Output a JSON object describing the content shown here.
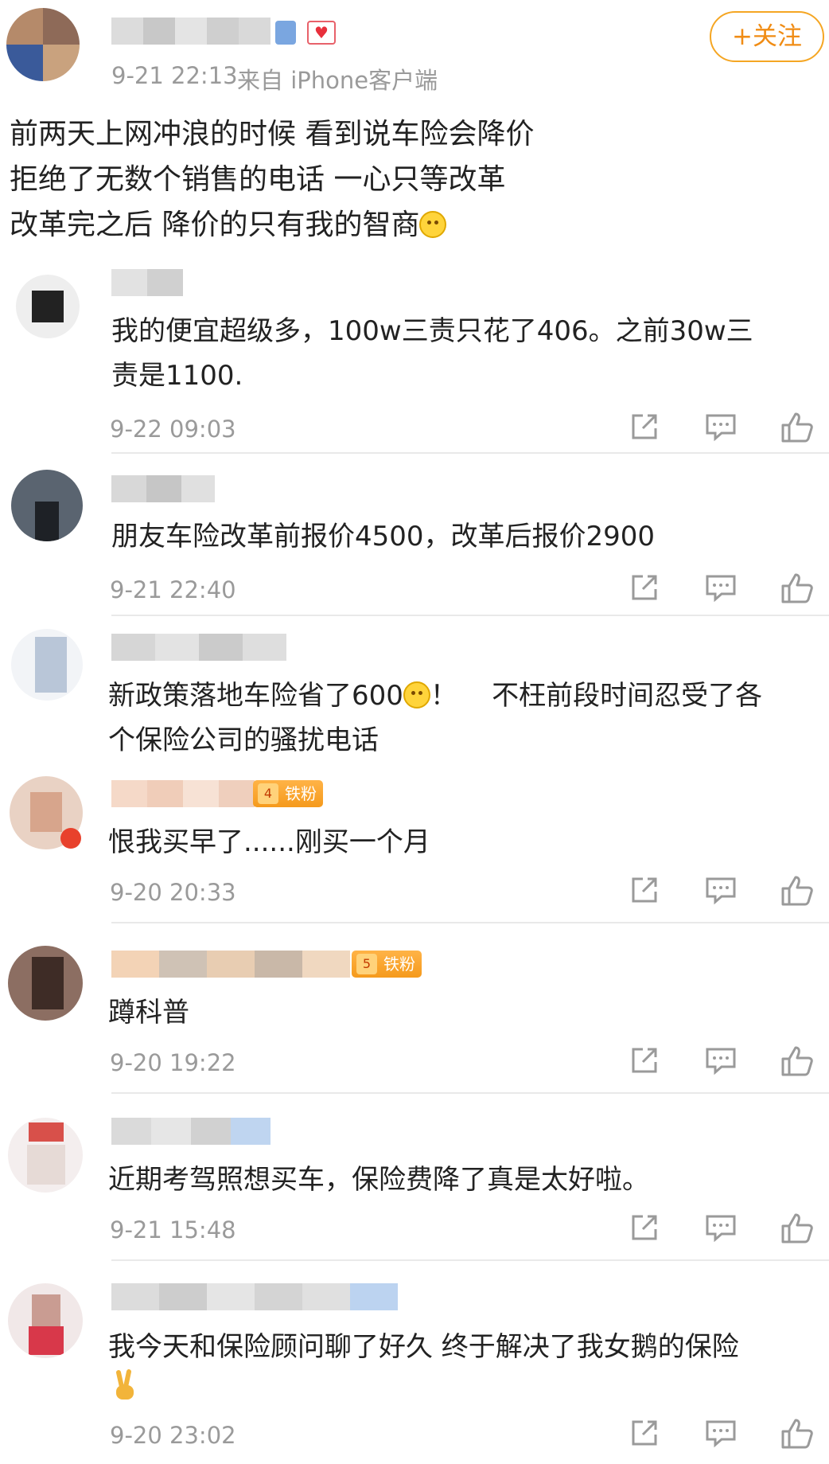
{
  "post": {
    "time": "9-21 22:13",
    "source": "来自 iPhone客户端",
    "follow_label": "+关注",
    "lines": [
      "前两天上网冲浪的时候 看到说车险会降价",
      "拒绝了无数个销售的电话 一心只等改革",
      "改革完之后 降价的只有我的智商"
    ],
    "emoji": "thinking-face-icon"
  },
  "comments": [
    {
      "lines": [
        "我的便宜超级多，100w三责只花了406。之前30w三",
        "责是1100."
      ],
      "time": "9-22 09:03"
    },
    {
      "lines": [
        "朋友车险改革前报价4500，改革后报价2900"
      ],
      "time": "9-21 22:40"
    },
    {
      "lines": [
        "新政策落地车险省了600",
        "个保险公司的骚扰电话"
      ],
      "line1_after_emoji": "！    不枉前段时间忍受了各",
      "time": ""
    },
    {
      "badge": "铁粉",
      "lines": [
        "恨我买早了......刚买一个月"
      ],
      "time": "9-20 20:33"
    },
    {
      "badge": "铁粉",
      "lines": [
        "蹲科普"
      ],
      "time": "9-20 19:22"
    },
    {
      "lines": [
        "近期考驾照想买车，保险费降了真是太好啦。"
      ],
      "time": "9-21 15:48"
    },
    {
      "lines": [
        "我今天和保险顾问聊了好久 终于解决了我女鹅的保险"
      ],
      "time": "9-20 23:02"
    }
  ],
  "colors": {
    "accent": "#f08c14",
    "meta": "#9a9a9a",
    "text": "#222222",
    "divider": "#e9e9e9"
  }
}
